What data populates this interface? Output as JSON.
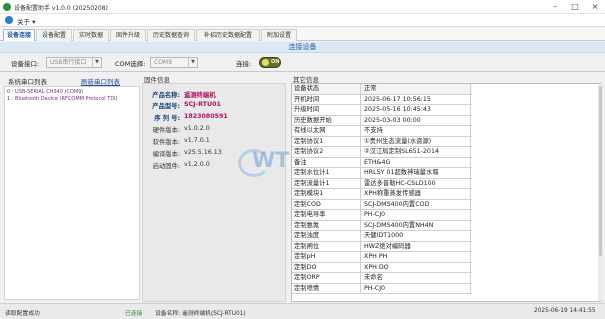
{
  "window": {
    "title": "设备配置助手 v1.0.0 (20250208)",
    "minimize": "–",
    "maximize": "□",
    "close": "×"
  },
  "menu": {
    "about": "关于",
    "about_arrow": "▾"
  },
  "tabs": [
    {
      "label": "设备连接",
      "active": true
    },
    {
      "label": "设备配置",
      "active": false
    },
    {
      "label": "实时数据",
      "active": false
    },
    {
      "label": "固件升级",
      "active": false
    },
    {
      "label": "历史数据查询",
      "active": false
    },
    {
      "label": "补招历史数据配置",
      "active": false
    },
    {
      "label": "附加设置",
      "active": false
    }
  ],
  "connection": {
    "header": "连接设备",
    "interface_label": "设备接口:",
    "interface_value": "USB串行接口",
    "com_label": "COM选择:",
    "com_value": "COM9",
    "connect_label": "连接:",
    "toggle_state": "ON",
    "toggle_on": true
  },
  "ports": {
    "title": "系统串口列表",
    "refresh_label": "刷新串口列表",
    "items": [
      "0 : USB-SERIAL CH340 (COM9)",
      "1 : Bluetooth Device (RFCOMM Protocol TDI)"
    ]
  },
  "device_info": {
    "title": "固件信息",
    "rows": [
      {
        "label": "产品名称:",
        "value": "遥测终端机",
        "style": "hi"
      },
      {
        "label": "产品型号:",
        "value": "SCJ-RTU01",
        "style": "hi"
      },
      {
        "label": "序 列 号:",
        "value": "1823080591",
        "style": "hi"
      },
      {
        "label": "硬件版本:",
        "value": "v1.0.2.0",
        "style": ""
      },
      {
        "label": "软件版本:",
        "value": "v1.7.0.1",
        "style": ""
      },
      {
        "label": "编译版本:",
        "value": "v25.5.16.13",
        "style": ""
      },
      {
        "label": "启动固件:",
        "value": "v1.2.0.0",
        "style": ""
      }
    ]
  },
  "other_info": {
    "title": "其它信息",
    "rows": [
      [
        "设备状态",
        "正常"
      ],
      [
        "开机时间",
        "2025-06-17 10:56:15"
      ],
      [
        "升级时间",
        "2025-05-16 10:45:43"
      ],
      [
        "历史数据开始",
        "2025-03-03 00:00"
      ],
      [
        "有线以太网",
        "不支持"
      ],
      [
        "定制协议1",
        "①贵州生态流量(水资源)"
      ],
      [
        "定制协议2",
        "②汉江局定制SL651-2014"
      ],
      [
        "备注",
        "ETH&4G"
      ],
      [
        "定制水位计1",
        "HRLSY 01超数神瑞量水堰"
      ],
      [
        "定制流量计1",
        "雷达多普勒HC-CSLD100"
      ],
      [
        "定制模块1",
        "XPH称重蒸发传感器"
      ],
      [
        "定制COD",
        "SCJ-DMS400内置COD"
      ],
      [
        "定制电导率",
        "PH-CJ0"
      ],
      [
        "定制氨氮",
        "SCJ-DMS400内置NH4N"
      ],
      [
        "定制浊度",
        "天健IDT1000"
      ],
      [
        "定制闸位",
        "HWZ绝对编码器"
      ],
      [
        "定制pH",
        "XPH PH"
      ],
      [
        "定制DO",
        "XPH DO"
      ],
      [
        "定制ORP",
        "未命名"
      ],
      [
        "定制喷情",
        "PH-CJ0"
      ]
    ]
  },
  "watermark": {
    "text": "WTP expert"
  },
  "status": {
    "message": "读取配置成功",
    "connection": "已连接",
    "device": "设备名称: 遥测终端机(SCJ-RTU01)",
    "timestamp": "2025-06-19 14:41:55"
  },
  "colors": {
    "accent": "#1a55a6",
    "highlight": "#b01060",
    "connected": "#2a8a2a",
    "port_text": "#7b2a8a"
  }
}
